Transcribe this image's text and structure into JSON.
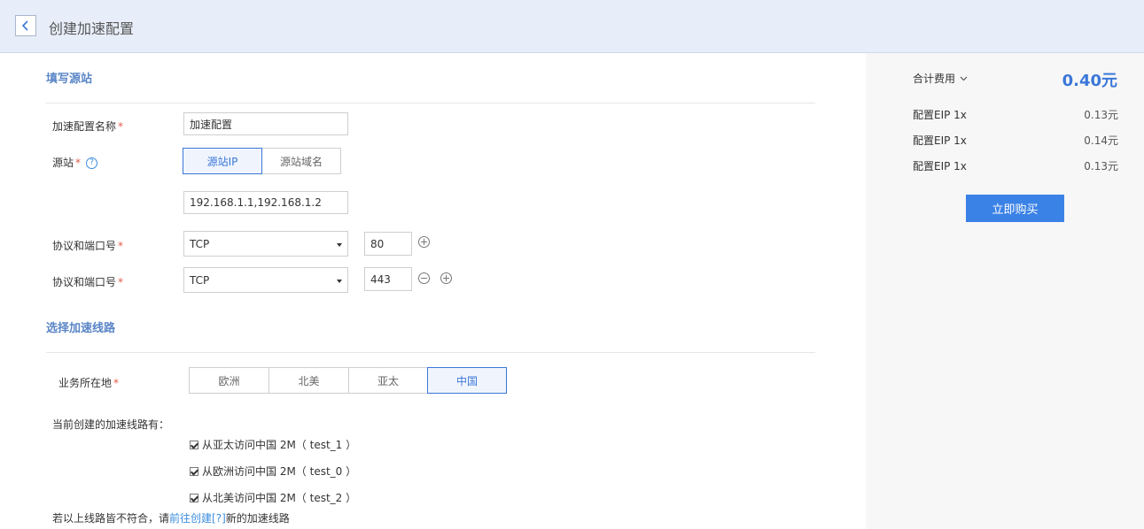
{
  "header": {
    "title": "创建加速配置"
  },
  "source": {
    "section_title": "填写源站",
    "name_label": "加速配置名称",
    "name_value": "加速配置",
    "origin_label": "源站",
    "origin_tabs": [
      "源站IP",
      "源站域名"
    ],
    "ip_value": "192.168.1.1,192.168.1.2",
    "protocol_rows": [
      {
        "label": "协议和端口号",
        "protocol": "TCP",
        "port": "80"
      },
      {
        "label": "协议和端口号",
        "protocol": "TCP",
        "port": "443"
      }
    ]
  },
  "route": {
    "section_title": "选择加速线路",
    "region_label": "业务所在地",
    "regions": [
      "欧洲",
      "北美",
      "亚太",
      "中国"
    ],
    "selected_region": "中国",
    "current_lines_label": "当前创建的加速线路有：",
    "lines": [
      "从亚太访问中国 2M（ test_1 ）",
      "从欧洲访问中国 2M（ test_0 ）",
      "从北美访问中国 2M（ test_2 ）"
    ],
    "footer_prefix": "若以上线路皆不符合，请",
    "footer_link": "前往创建[?]",
    "footer_suffix": "新的加速线路"
  },
  "summary": {
    "total_label": "合计费用",
    "total_price": "0.40元",
    "items": [
      {
        "name": "配置EIP 1x",
        "price": "0.13元"
      },
      {
        "name": "配置EIP 1x",
        "price": "0.14元"
      },
      {
        "name": "配置EIP 1x",
        "price": "0.13元"
      }
    ],
    "buy_label": "立即购买"
  },
  "colors": {
    "accent": "#3b77d9",
    "header_bg": "#e8eef9",
    "required": "#e05a4a",
    "button": "#3b82e6"
  }
}
